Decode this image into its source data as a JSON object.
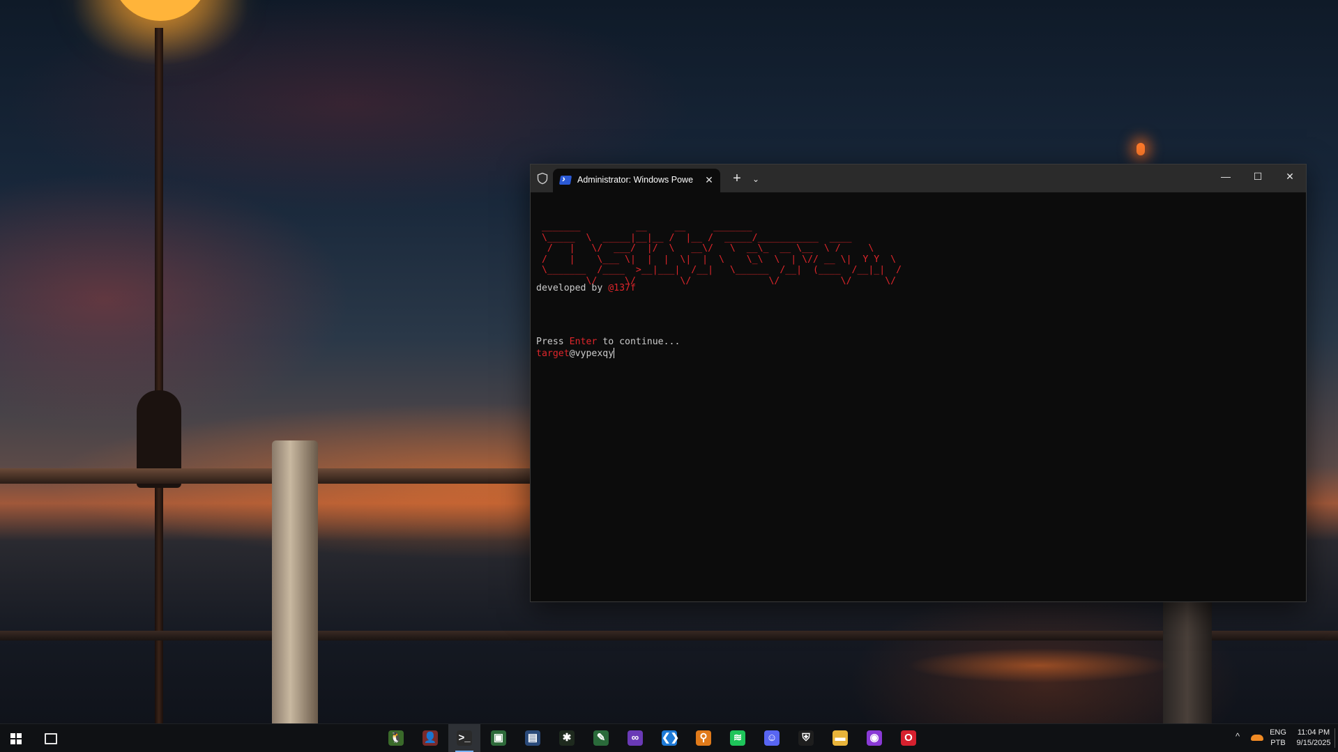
{
  "terminal": {
    "tab_title": "Administrator: Windows Powe",
    "tab_icon": "powershell-icon",
    "new_tab_symbol": "+",
    "dropdown_symbol": "⌄",
    "close_tab_symbol": "✕",
    "window_buttons": {
      "minimize": "—",
      "maximize": "☐",
      "close": "✕"
    },
    "ascii_banner": " _______          __     __     _______\n \\_____  \\  _____|__|__ /  |__ /  _____/___________  ____\n  /   |   \\/  ___/  |/  \\   __\\/   \\  __\\_  __ \\__  \\ /     \\\n /    |    \\___ \\|  |  |  \\|  |  \\    \\_\\  \\  | \\// __ \\|  Y Y  \\\n \\_______  /____  >__|___|  /__|   \\______  /__|  (____  /__|_|  /\n         \\/     \\/        \\/              \\/           \\/      \\/",
    "credit_prefix": "developed by ",
    "credit_handle": "@137f",
    "prompt_press": "Press ",
    "prompt_key": "Enter",
    "prompt_rest": " to continue...",
    "input_label": "target",
    "input_value": "@vypexqy",
    "accent_color": "#e0262b"
  },
  "taskbar": {
    "apps": [
      {
        "name": "app-penguin-icon",
        "glyph": "🐧",
        "bg": "#3a6a2a"
      },
      {
        "name": "app-avatar-icon",
        "glyph": "👤",
        "bg": "#7a2a2a"
      },
      {
        "name": "terminal-icon",
        "glyph": ">_",
        "bg": "#2a2a2a",
        "active": true
      },
      {
        "name": "app-monitor-icon",
        "glyph": "▣",
        "bg": "#2e6a3a"
      },
      {
        "name": "app-remote-icon",
        "glyph": "▤",
        "bg": "#2a4a7a"
      },
      {
        "name": "app-bug-icon",
        "glyph": "✱",
        "bg": "#1e2a1e"
      },
      {
        "name": "app-tool-icon",
        "glyph": "✎",
        "bg": "#2a6a3a"
      },
      {
        "name": "visual-studio-icon",
        "glyph": "∞",
        "bg": "#6a3ab6"
      },
      {
        "name": "vscode-icon",
        "glyph": "❮❯",
        "bg": "#1e7ad6"
      },
      {
        "name": "search-tool-icon",
        "glyph": "⚲",
        "bg": "#e07a1a"
      },
      {
        "name": "spotify-icon",
        "glyph": "≋",
        "bg": "#1ec45a"
      },
      {
        "name": "discord-icon",
        "glyph": "☺",
        "bg": "#5865f2"
      },
      {
        "name": "shield-app-icon",
        "glyph": "⛨",
        "bg": "#1e1e1e"
      },
      {
        "name": "file-explorer-icon",
        "glyph": "▬",
        "bg": "#e8b43a"
      },
      {
        "name": "mask-app-icon",
        "glyph": "◉",
        "bg": "#8a3ad6"
      },
      {
        "name": "opera-icon",
        "glyph": "O",
        "bg": "#d6202e"
      }
    ],
    "tray": {
      "chevron": "^",
      "lang_top": "ENG",
      "lang_bottom": "PTB",
      "time": "11:04 PM",
      "date": "9/15/2025"
    }
  }
}
